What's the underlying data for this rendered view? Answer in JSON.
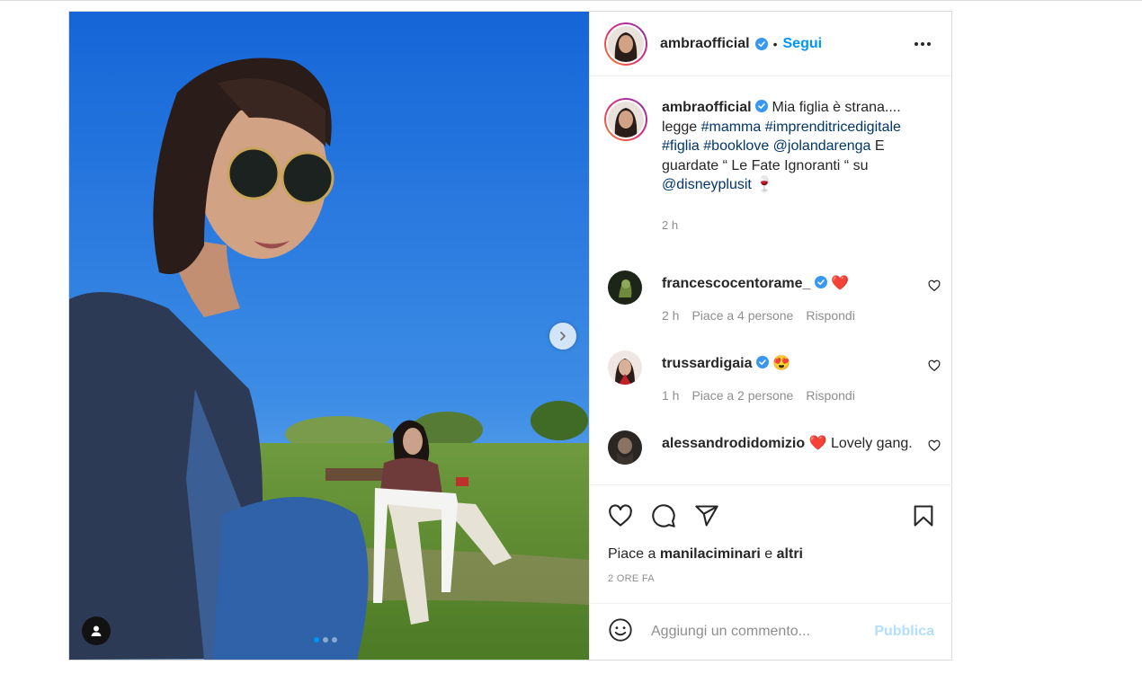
{
  "post": {
    "author": {
      "username": "ambraofficial",
      "verified": true,
      "verified_icon": "verified-badge-icon"
    },
    "follow_label": "Segui",
    "separator": "•",
    "more_icon": "more-options-icon",
    "caption": {
      "username": "ambraofficial",
      "text_parts": [
        {
          "text": " Mia figlia è strana.... legge ",
          "type": "plain"
        },
        {
          "text": "#mamma",
          "type": "tag"
        },
        {
          "text": " ",
          "type": "plain"
        },
        {
          "text": "#imprenditricedigitale",
          "type": "tag"
        },
        {
          "text": " ",
          "type": "plain"
        },
        {
          "text": "#figlia",
          "type": "tag"
        },
        {
          "text": " ",
          "type": "plain"
        },
        {
          "text": "#booklove",
          "type": "tag"
        },
        {
          "text": " ",
          "type": "plain"
        },
        {
          "text": "@jolandarenga",
          "type": "tag"
        },
        {
          "text": " E guardate “ Le Fate Ignoranti “ su ",
          "type": "plain"
        },
        {
          "text": "@disneyplusit",
          "type": "tag"
        },
        {
          "text": " 🍷",
          "type": "plain"
        }
      ],
      "time": "2 h"
    },
    "comments": [
      {
        "username": "francescocentorame_",
        "verified": true,
        "text": "❤️",
        "time": "2 h",
        "likes": "Piace a 4 persone",
        "reply": "Rispondi"
      },
      {
        "username": "trussardigaia",
        "verified": true,
        "text": "😍",
        "time": "1 h",
        "likes": "Piace a 2 persone",
        "reply": "Rispondi"
      },
      {
        "username": "alessandrodidomizio",
        "verified": false,
        "text": "❤️ Lovely gang.",
        "time": "",
        "likes": "",
        "reply": ""
      }
    ],
    "actions": {
      "like_icon": "heart-icon",
      "comment_icon": "comment-icon",
      "share_icon": "share-icon",
      "save_icon": "bookmark-icon"
    },
    "likes": {
      "prefix": "Piace a ",
      "user": "manilaciminari",
      "middle": " e ",
      "others": "altri"
    },
    "date": "2 ORE FA",
    "add_comment": {
      "emoji_icon": "emoji-icon",
      "placeholder": "Aggiungi un commento...",
      "publish_label": "Pubblica"
    },
    "media": {
      "carousel_total": 3,
      "carousel_index": 1,
      "next_icon": "chevron-right-icon",
      "tag_icon": "user-tag-icon"
    },
    "colors": {
      "link_blue": "#0095f6",
      "tag_blue": "#00376b",
      "heart_red": "#ed4956",
      "publish_disabled": "#b2dffc",
      "verified_blue": "#3897f0"
    }
  }
}
